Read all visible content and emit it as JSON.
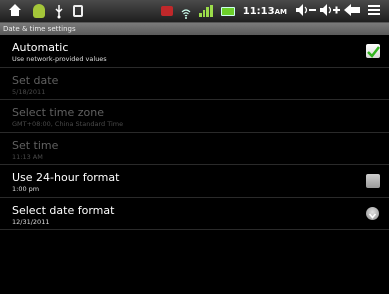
{
  "status_bar": {
    "left_icons": [
      "home-icon",
      "android-apk-icon",
      "usb-icon",
      "lock-icon"
    ],
    "right_icons": [
      "notification-icon",
      "wifi-icon",
      "signal-bars-icon",
      "battery-icon"
    ],
    "time": "11:13",
    "ampm": "AM",
    "buttons": [
      "volume-down-button",
      "volume-up-button",
      "back-button",
      "menu-button"
    ]
  },
  "header": {
    "title": "Date & time settings"
  },
  "settings": [
    {
      "title": "Automatic",
      "summary": "Use network-provided values",
      "control": "checkbox",
      "checked": true,
      "enabled": true
    },
    {
      "title": "Set date",
      "summary": "5/18/2011",
      "control": "none",
      "enabled": false
    },
    {
      "title": "Select time zone",
      "summary": "GMT+08:00, China Standard Time",
      "control": "none",
      "enabled": false
    },
    {
      "title": "Set time",
      "summary": "11:13 AM",
      "control": "none",
      "enabled": false
    },
    {
      "title": "Use 24-hour format",
      "summary": "1:00 pm",
      "control": "checkbox",
      "checked": false,
      "enabled": true
    },
    {
      "title": "Select date format",
      "summary": "12/31/2011",
      "control": "radio",
      "enabled": true
    }
  ],
  "colors": {
    "checkmark": "#33b520",
    "disabled_text": "#606060"
  }
}
